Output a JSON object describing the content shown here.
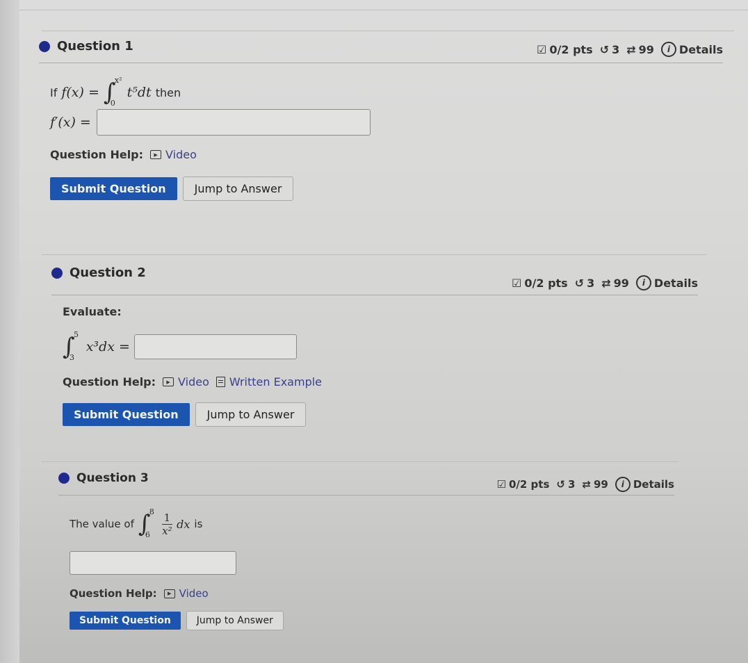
{
  "questions": [
    {
      "title": "Question 1",
      "points": "0/2 pts",
      "retries": "3",
      "attempts": "99",
      "details_label": "Details",
      "prompt_prefix": "If",
      "prompt_lhs": "f(x) =",
      "integral_lower": "0",
      "integral_upper": "x²",
      "integrand": "t⁵dt",
      "prompt_suffix": "then",
      "answer_label": "f′(x) =",
      "answer_value": "",
      "help_label": "Question Help:",
      "help_links": [
        "Video"
      ],
      "submit_label": "Submit Question",
      "jump_label": "Jump to Answer"
    },
    {
      "title": "Question 2",
      "points": "0/2 pts",
      "retries": "3",
      "attempts": "99",
      "details_label": "Details",
      "prompt": "Evaluate:",
      "integral_lower": "3",
      "integral_upper": "5",
      "integrand": "x³dx =",
      "answer_value": "",
      "help_label": "Question Help:",
      "help_links": [
        "Video",
        "Written Example"
      ],
      "submit_label": "Submit Question",
      "jump_label": "Jump to Answer"
    },
    {
      "title": "Question 3",
      "points": "0/2 pts",
      "retries": "3",
      "attempts": "99",
      "details_label": "Details",
      "prompt_prefix": "The value of",
      "integral_lower": "6",
      "integral_upper": "8",
      "frac_num": "1",
      "frac_den": "x²",
      "integrand_tail": "dx",
      "prompt_suffix": "is",
      "answer_value": "",
      "help_label": "Question Help:",
      "help_links": [
        "Video"
      ],
      "submit_label": "Submit Question",
      "jump_label": "Jump to Answer"
    }
  ],
  "colors": {
    "accent": "#1c55b0",
    "dot": "#1e2b8c",
    "link": "#3b3f8a"
  }
}
